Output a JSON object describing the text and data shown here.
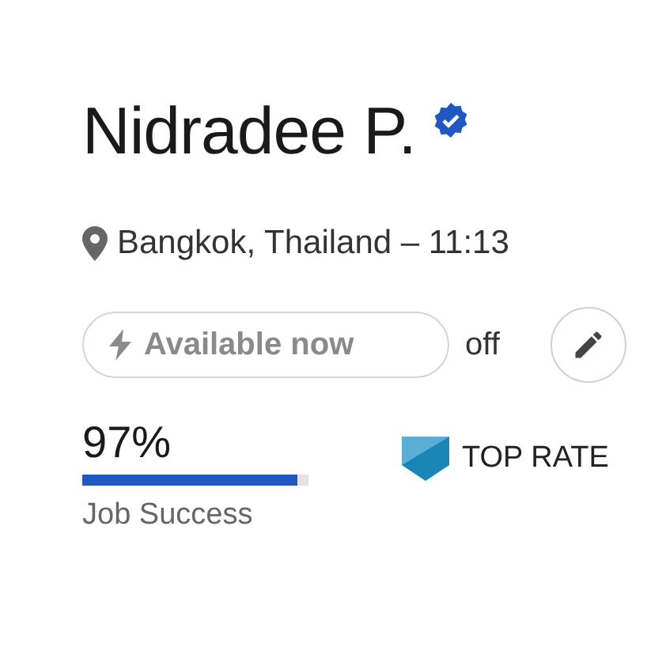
{
  "profile": {
    "name": "Nidradee P.",
    "verified": true,
    "location": "Bangkok, Thailand – 11:13"
  },
  "availability": {
    "label": "Available now",
    "on": false,
    "state_text": "off"
  },
  "job_success": {
    "value": "97%",
    "level": 0.95,
    "label": "Job Success"
  },
  "badge": {
    "label": "TOP RATE"
  }
}
